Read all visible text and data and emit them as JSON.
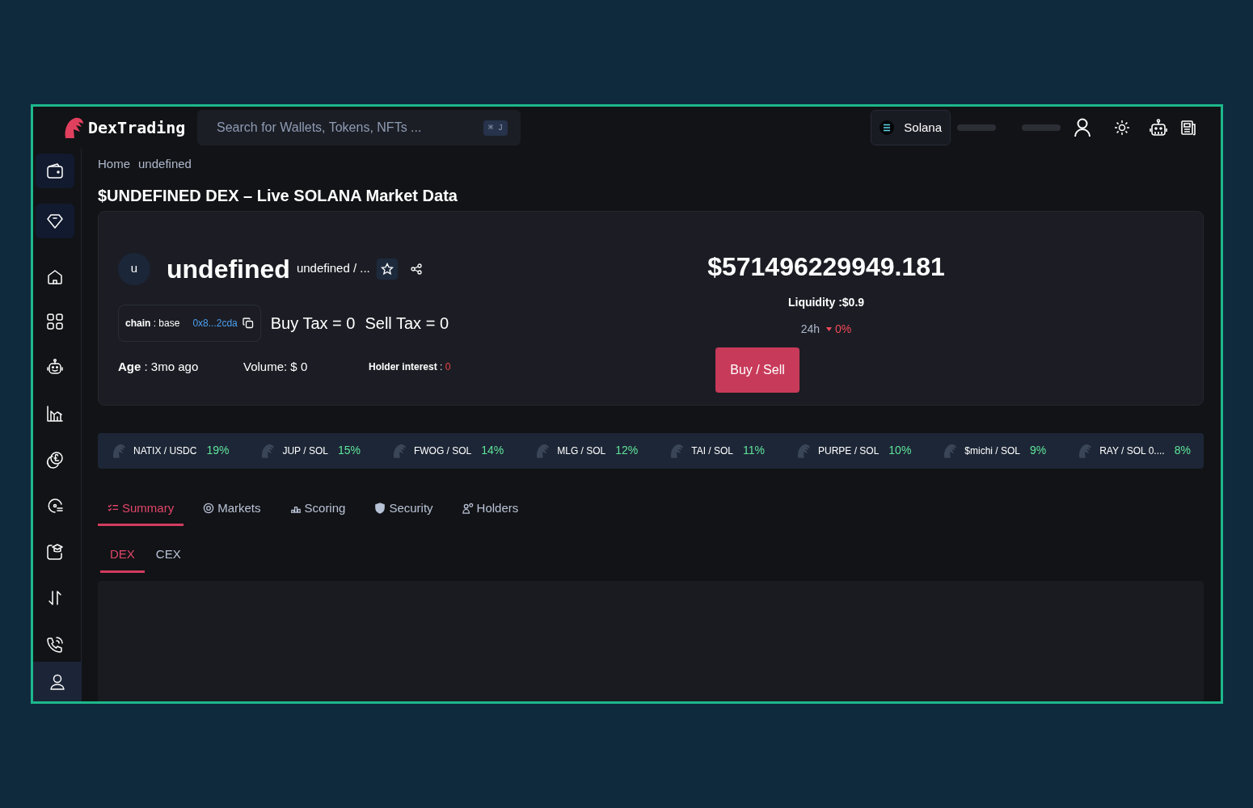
{
  "header": {
    "logo_text": "DexTrading",
    "search": {
      "placeholder": "Search for Wallets, Tokens, NFTs ...",
      "shortcut": "⌘ J"
    },
    "network": "Solana"
  },
  "sidebar": {
    "items": [
      {
        "highlighted": true
      },
      {
        "highlighted": true
      },
      {
        "highlighted": false
      },
      {
        "highlighted": false
      },
      {
        "highlighted": false
      },
      {
        "highlighted": false
      },
      {
        "highlighted": false
      },
      {
        "highlighted": false
      },
      {
        "highlighted": false
      },
      {
        "highlighted": false
      },
      {
        "highlighted": false
      },
      {
        "highlighted": true
      }
    ]
  },
  "breadcrumb": [
    "Home",
    "undefined"
  ],
  "page_title": "$UNDEFINED DEX – Live SOLANA Market Data",
  "token": {
    "avatar": "u",
    "name": "undefined",
    "pair": "undefined / ...",
    "chain": "**chain** : base",
    "address": "0x8...2cda",
    "buy_tax": "Buy Tax = 0",
    "sell_tax": "Sell Tax = 0",
    "age": "**Age** : 3mo ago",
    "volume": "Volume: $ 0",
    "holder_label": "**Holder interest** :",
    "holder_value": "0",
    "price": "$571496229949.181",
    "liquidity": "Liquidity :$0.9",
    "period": "24h",
    "change": "0%",
    "buy_sell": "Buy / Sell"
  },
  "ticker": [
    {
      "pair": "NATIX / USDC",
      "change": "19%"
    },
    {
      "pair": "JUP / SOL",
      "change": "15%"
    },
    {
      "pair": "FWOG / SOL",
      "change": "14%"
    },
    {
      "pair": "MLG / SOL",
      "change": "12%"
    },
    {
      "pair": "TAI / SOL",
      "change": "11%"
    },
    {
      "pair": "PURPE / SOL",
      "change": "10%"
    },
    {
      "pair": "$michi / SOL",
      "change": "9%"
    },
    {
      "pair": "RAY / SOL 0....",
      "change": "8%"
    }
  ],
  "tabs": [
    {
      "label": "Summary",
      "selected": true
    },
    {
      "label": "Markets",
      "selected": false
    },
    {
      "label": "Scoring",
      "selected": false
    },
    {
      "label": "Security",
      "selected": false
    },
    {
      "label": "Holders",
      "selected": false
    }
  ],
  "subtabs": [
    {
      "label": "DEX",
      "selected": true
    },
    {
      "label": "CEX",
      "selected": false
    }
  ]
}
